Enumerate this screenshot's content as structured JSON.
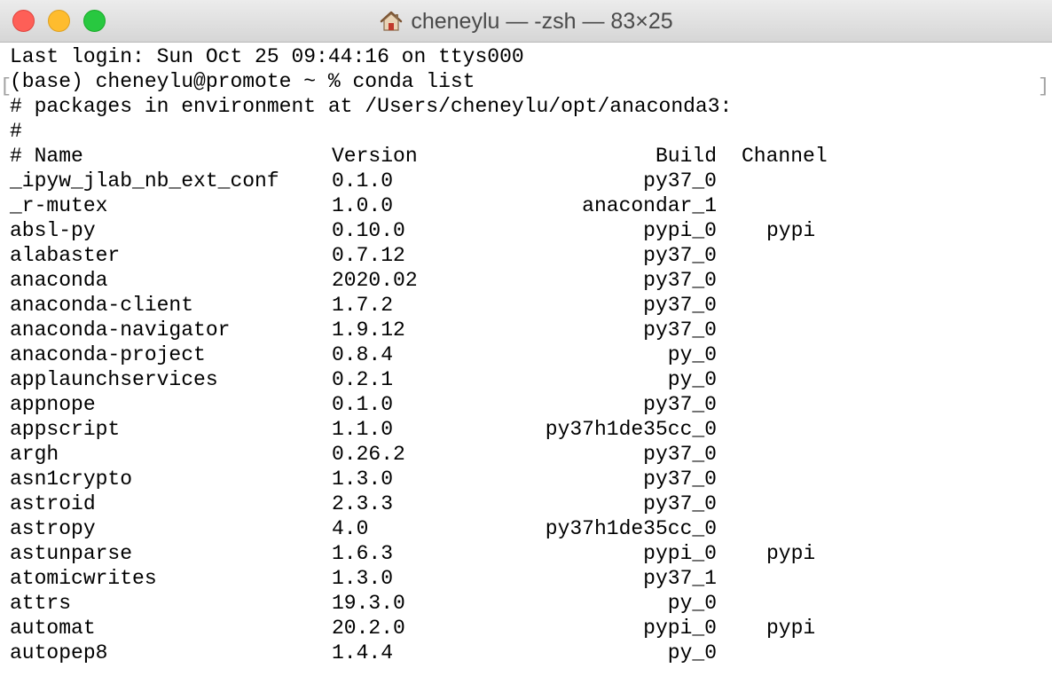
{
  "window": {
    "title": "cheneylu — -zsh — 83×25"
  },
  "terminal": {
    "last_login": "Last login: Sun Oct 25 09:44:16 on ttys000",
    "prompt": "(base) cheneylu@promote ~ % conda list",
    "env_line": "# packages in environment at /Users/cheneylu/opt/anaconda3:",
    "hash_line": "#",
    "bracket_left": "[",
    "bracket_right": "]",
    "headers": {
      "name": "# Name",
      "version": "Version",
      "build": "Build",
      "channel": "Channel"
    },
    "packages": [
      {
        "name": "_ipyw_jlab_nb_ext_conf",
        "version": "0.1.0",
        "build": "py37_0",
        "channel": ""
      },
      {
        "name": "_r-mutex",
        "version": "1.0.0",
        "build": "anacondar_1",
        "channel": ""
      },
      {
        "name": "absl-py",
        "version": "0.10.0",
        "build": "pypi_0",
        "channel": "pypi"
      },
      {
        "name": "alabaster",
        "version": "0.7.12",
        "build": "py37_0",
        "channel": ""
      },
      {
        "name": "anaconda",
        "version": "2020.02",
        "build": "py37_0",
        "channel": ""
      },
      {
        "name": "anaconda-client",
        "version": "1.7.2",
        "build": "py37_0",
        "channel": ""
      },
      {
        "name": "anaconda-navigator",
        "version": "1.9.12",
        "build": "py37_0",
        "channel": ""
      },
      {
        "name": "anaconda-project",
        "version": "0.8.4",
        "build": "py_0",
        "channel": ""
      },
      {
        "name": "applaunchservices",
        "version": "0.2.1",
        "build": "py_0",
        "channel": ""
      },
      {
        "name": "appnope",
        "version": "0.1.0",
        "build": "py37_0",
        "channel": ""
      },
      {
        "name": "appscript",
        "version": "1.1.0",
        "build": "py37h1de35cc_0",
        "channel": ""
      },
      {
        "name": "argh",
        "version": "0.26.2",
        "build": "py37_0",
        "channel": ""
      },
      {
        "name": "asn1crypto",
        "version": "1.3.0",
        "build": "py37_0",
        "channel": ""
      },
      {
        "name": "astroid",
        "version": "2.3.3",
        "build": "py37_0",
        "channel": ""
      },
      {
        "name": "astropy",
        "version": "4.0",
        "build": "py37h1de35cc_0",
        "channel": ""
      },
      {
        "name": "astunparse",
        "version": "1.6.3",
        "build": "pypi_0",
        "channel": "pypi"
      },
      {
        "name": "atomicwrites",
        "version": "1.3.0",
        "build": "py37_1",
        "channel": ""
      },
      {
        "name": "attrs",
        "version": "19.3.0",
        "build": "py_0",
        "channel": ""
      },
      {
        "name": "automat",
        "version": "20.2.0",
        "build": "pypi_0",
        "channel": "pypi"
      },
      {
        "name": "autopep8",
        "version": "1.4.4",
        "build": "py_0",
        "channel": ""
      }
    ]
  }
}
